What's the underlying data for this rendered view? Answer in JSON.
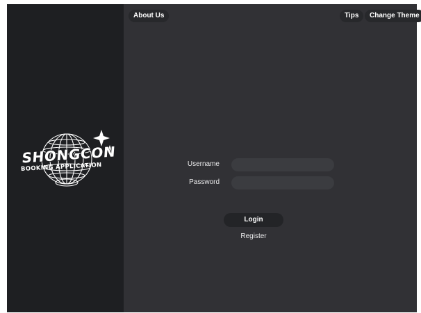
{
  "colors": {
    "main_bg": "#313135",
    "sidebar_bg": "#1e1f22",
    "button_bg": "#27282b",
    "input_bg": "#3b3c40",
    "text": "#ffffff"
  },
  "sidebar": {
    "logo": {
      "brand": "SHONGCON",
      "tagline": "BOOKING APPLICATION",
      "icon": "globe-sparkle-logo"
    }
  },
  "topbar": {
    "about_label": "About Us",
    "tips_label": "Tips",
    "theme_label": "Change Theme"
  },
  "login_form": {
    "username_label": "Username",
    "password_label": "Password",
    "username_value": "",
    "password_value": "",
    "login_label": "Login",
    "register_label": "Register"
  }
}
